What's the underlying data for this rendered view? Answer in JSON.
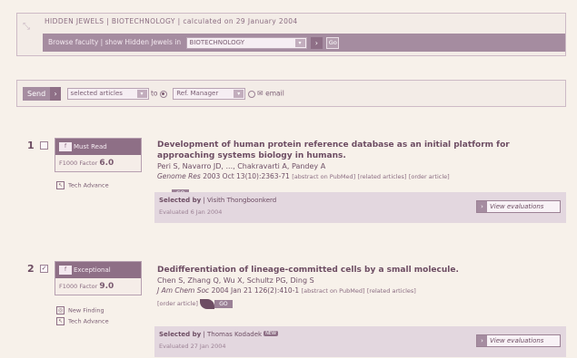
{
  "header": {
    "breadcrumb": "HIDDEN JEWELS | BIOTECHNOLOGY | calculated on 29 January 2004",
    "browse_label": "Browse faculty | show Hidden Jewels in",
    "category_value": "BIOTECHNOLOGY",
    "go_label": "Go"
  },
  "send_bar": {
    "send_label": "Send",
    "selection_value": "selected articles",
    "to_label": "to",
    "target_value": "Ref. Manager",
    "email_label": "email"
  },
  "articles": [
    {
      "number": "1",
      "checked": false,
      "rating": "Must Read",
      "factor_label": "F1000 Factor",
      "factor_value": "6.0",
      "tags": [
        "Tech Advance"
      ],
      "title": "Development of human protein reference database as an initial platform for approaching systems biology in humans.",
      "authors": "Peri S, Navarro JD, ..., Chakravarti A, Pandey A",
      "journal": "Genome Res",
      "citation": "2003 Oct 13(10):2363-71",
      "links": [
        "[abstract on PubMed]",
        "[related articles]",
        "[order article]"
      ],
      "link_logo": "GO",
      "selected_by_label": "Selected by",
      "selected_by": "Visith Thongboonkerd",
      "evaluated": "Evaluated 6 Jan 2004",
      "view_label": "View evaluations"
    },
    {
      "number": "2",
      "checked": true,
      "rating": "Exceptional",
      "factor_label": "F1000 Factor",
      "factor_value": "9.0",
      "tags": [
        "New Finding",
        "Tech Advance"
      ],
      "title": "Dedifferentiation of lineage-committed cells by a small molecule.",
      "authors": "Chen S, Zhang Q, Wu X, Schultz PG, Ding S",
      "journal": "J Am Chem Soc",
      "citation": "2004 Jan 21 126(2):410-1",
      "links": [
        "[abstract on PubMed]",
        "[related articles]",
        "[order article]"
      ],
      "link_logo": "GO",
      "selected_by_label": "Selected by",
      "selected_by": "Thomas Kodadek",
      "new_badge": "NEW",
      "evaluated": "Evaluated 27 Jan 2004",
      "view_label": "View evaluations"
    }
  ],
  "colors": {
    "accent": "#8e6f86",
    "background": "#f7f1ea",
    "band": "#a58ca0"
  }
}
